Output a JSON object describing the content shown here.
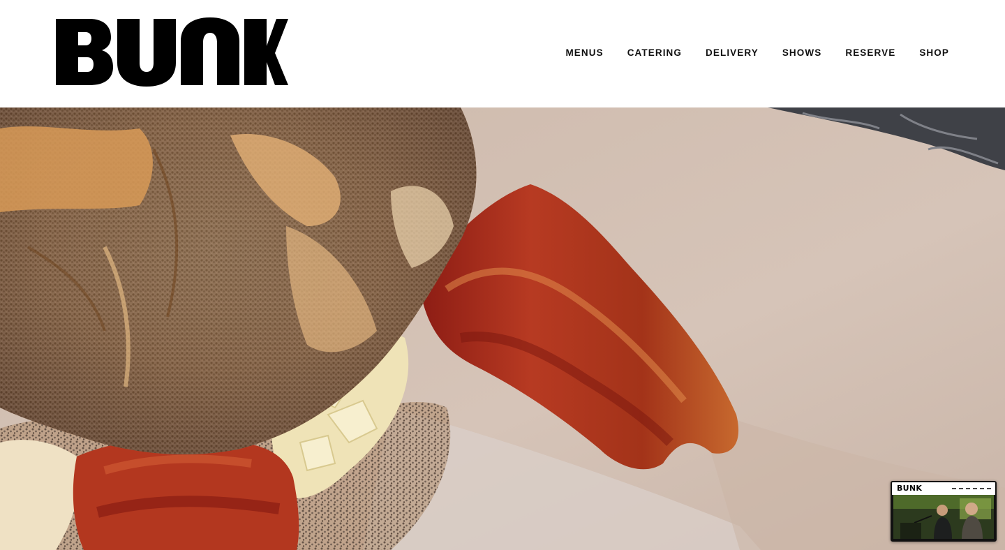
{
  "brand": {
    "name": "BUNK",
    "color": "#000000"
  },
  "nav": {
    "items": [
      {
        "label": "MENUS"
      },
      {
        "label": "CATERING"
      },
      {
        "label": "DELIVERY"
      },
      {
        "label": "SHOWS"
      },
      {
        "label": "RESERVE"
      },
      {
        "label": "SHOP"
      }
    ]
  },
  "hero": {
    "image": "bacon-egg-poppyseed-sandwich-photo"
  },
  "mini_card": {
    "logo": "BUNK",
    "image": "live-music-video-thumbnail"
  }
}
